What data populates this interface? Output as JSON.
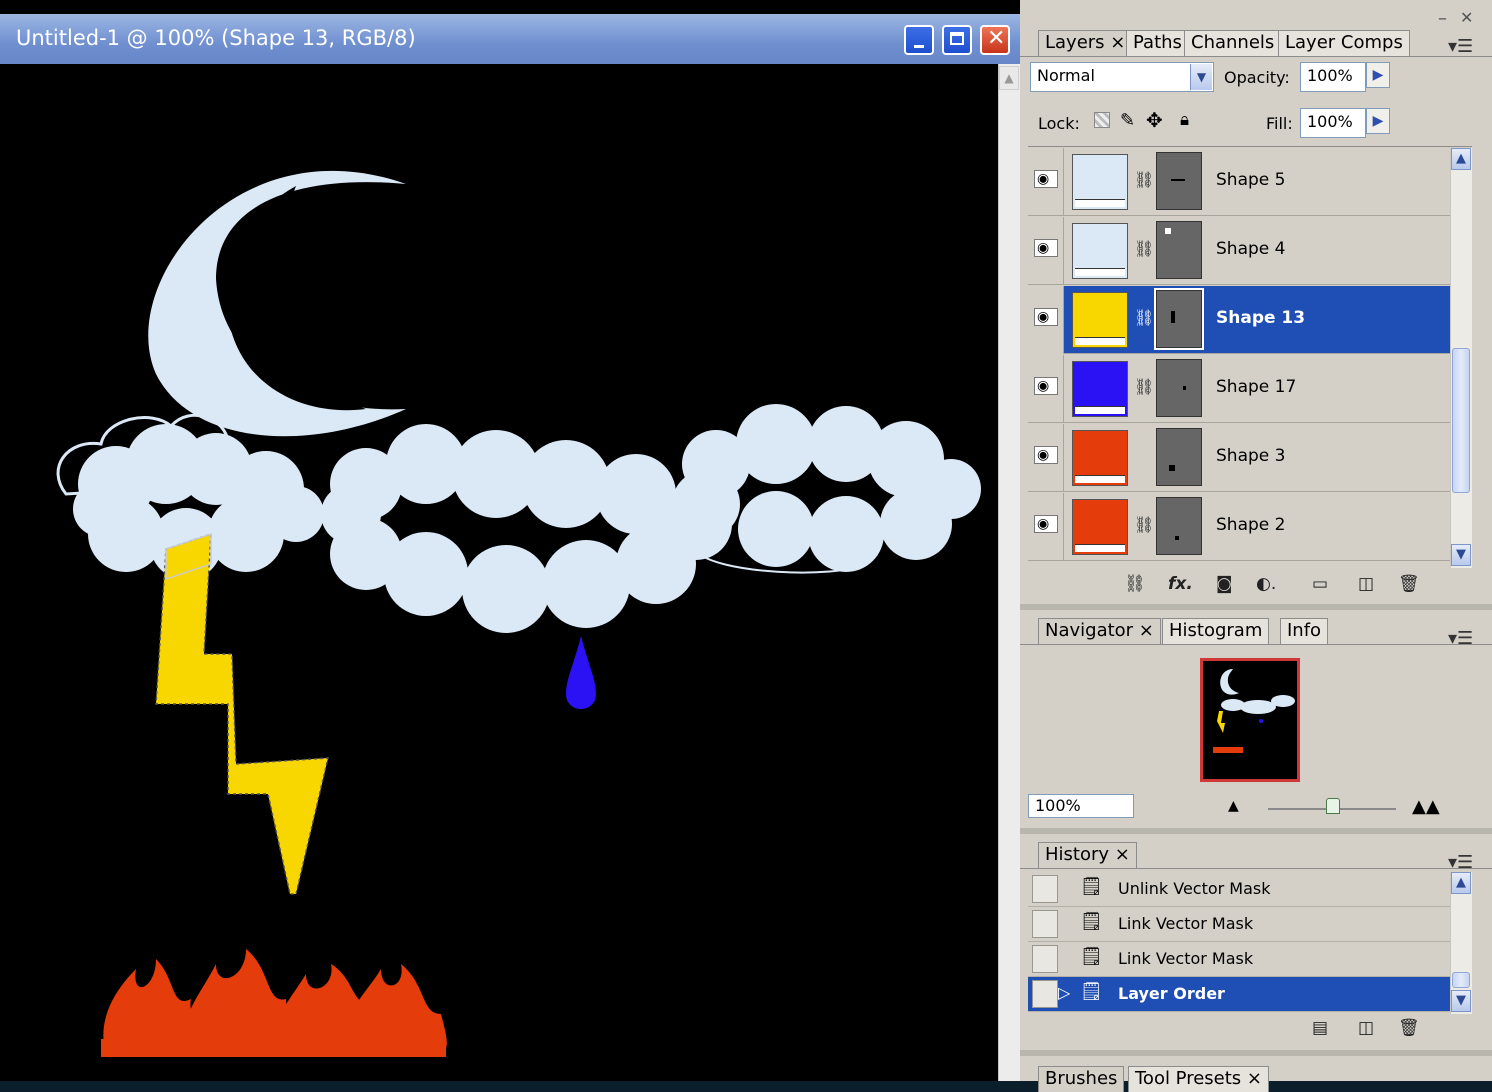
{
  "document": {
    "title": "Untitled-1 @ 100% (Shape 13, RGB/8)",
    "controls": {
      "minimize": "_",
      "maximize": "□",
      "close": "✕"
    }
  },
  "layers_panel": {
    "tabs": [
      "Layers ×",
      "Paths",
      "Channels",
      "Layer Comps"
    ],
    "blend_mode": "Normal",
    "opacity_label": "Opacity:",
    "opacity_value": "100%",
    "lock_label": "Lock:",
    "fill_label": "Fill:",
    "fill_value": "100%",
    "layers": [
      {
        "name": "Shape 5",
        "color": "#dbe9f6",
        "linked": true,
        "selected": false
      },
      {
        "name": "Shape 4",
        "color": "#dbe9f6",
        "linked": true,
        "selected": false
      },
      {
        "name": "Shape 13",
        "color": "#f8d600",
        "linked": true,
        "selected": true
      },
      {
        "name": "Shape 17",
        "color": "#2a12f4",
        "linked": true,
        "selected": false
      },
      {
        "name": "Shape 3",
        "color": "#e43c0b",
        "linked": false,
        "selected": false
      },
      {
        "name": "Shape 2",
        "color": "#e43c0b",
        "linked": true,
        "selected": false
      }
    ],
    "footer_icons": [
      "link-layers-icon",
      "fx-icon",
      "add-mask-icon",
      "adjustment-layer-icon",
      "new-group-icon",
      "new-layer-icon",
      "trash-icon"
    ]
  },
  "navigator_panel": {
    "tabs": [
      "Navigator ×",
      "Histogram",
      "Info"
    ],
    "zoom": "100%"
  },
  "history_panel": {
    "tabs": [
      "History ×"
    ],
    "items": [
      {
        "label": "Unlink Vector Mask",
        "selected": false
      },
      {
        "label": "Link Vector Mask",
        "selected": false
      },
      {
        "label": "Link Vector Mask",
        "selected": false
      },
      {
        "label": "Layer Order",
        "selected": true
      }
    ]
  },
  "bottom_tabs": [
    "Brushes",
    "Tool Presets ×"
  ],
  "colors": {
    "accent": "#1f4fb4",
    "moon": "#dbe9f6",
    "bolt": "#f8d600",
    "drop": "#2a12f4",
    "fire": "#e43c0b"
  }
}
